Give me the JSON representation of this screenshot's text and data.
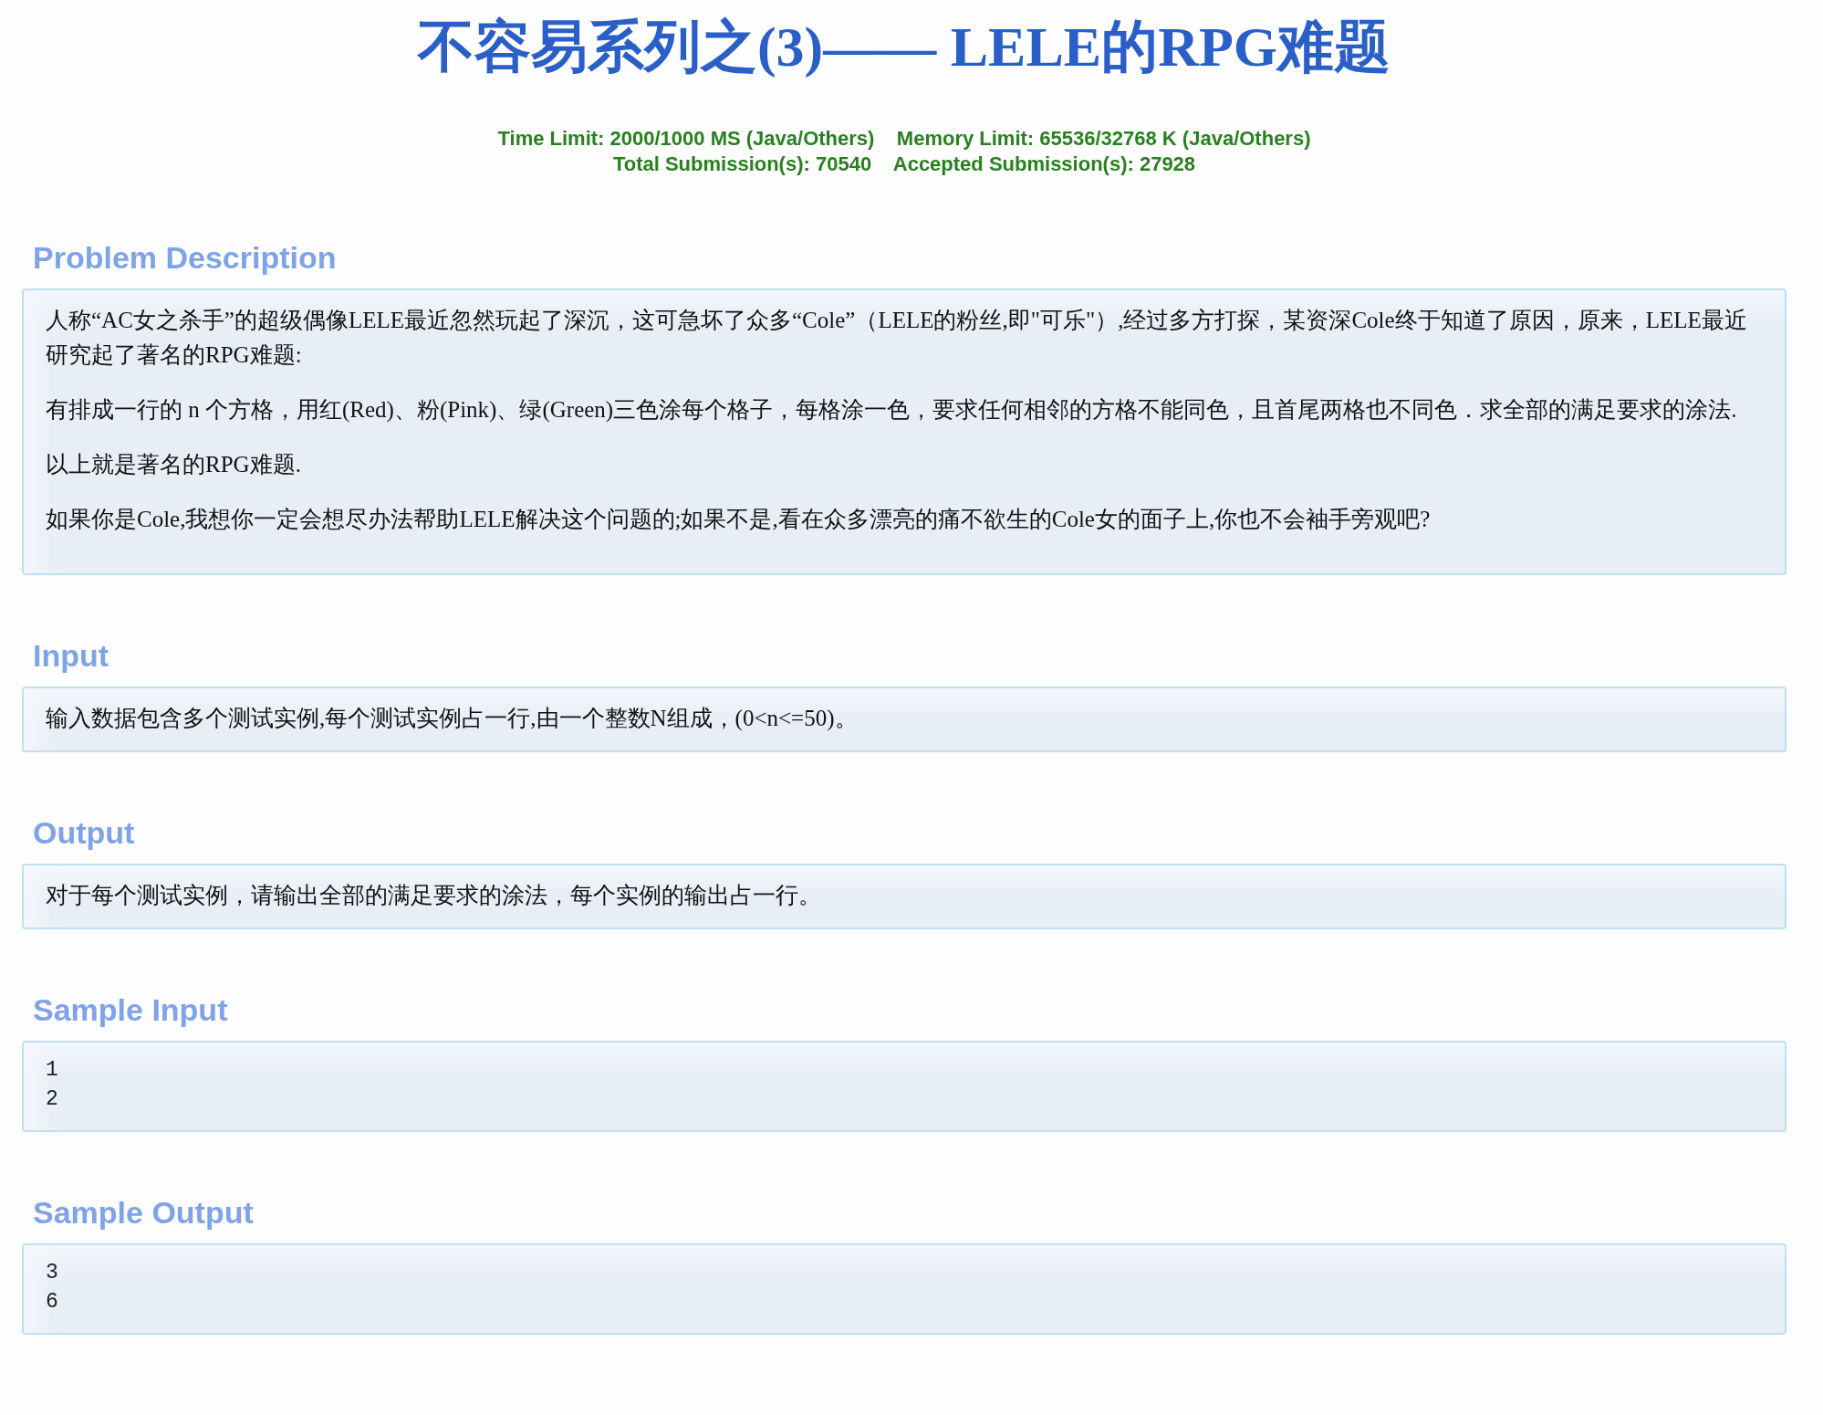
{
  "title": "不容易系列之(3)—— LELE的RPG难题",
  "limits": [
    "Time Limit: 2000/1000 MS (Java/Others)    Memory Limit: 65536/32768 K (Java/Others)",
    "Total Submission(s): 70540    Accepted Submission(s): 27928"
  ],
  "sections": [
    {
      "heading": "Problem Description",
      "kind": "text",
      "paragraphs": [
        "人称“AC女之杀手”的超级偶像LELE最近忽然玩起了深沉，这可急坏了众多“Cole”（LELE的粉丝,即\"可乐\"）,经过多方打探，某资深Cole终于知道了原因，原来，LELE最近研究起了著名的RPG难题:",
        "有排成一行的 n 个方格，用红(Red)、粉(Pink)、绿(Green)三色涂每个格子，每格涂一色，要求任何相邻的方格不能同色，且首尾两格也不同色．求全部的满足要求的涂法.",
        "以上就是著名的RPG难题.",
        "如果你是Cole,我想你一定会想尽办法帮助LELE解决这个问题的;如果不是,看在众多漂亮的痛不欲生的Cole女的面子上,你也不会袖手旁观吧?"
      ]
    },
    {
      "heading": "Input",
      "kind": "text",
      "paragraphs": [
        "输入数据包含多个测试实例,每个测试实例占一行,由一个整数N组成，(0<n<=50)。"
      ]
    },
    {
      "heading": "Output",
      "kind": "text",
      "paragraphs": [
        "对于每个测试实例，请输出全部的满足要求的涂法，每个实例的输出占一行。"
      ]
    },
    {
      "heading": "Sample Input",
      "kind": "code",
      "lines": [
        "1",
        "2"
      ]
    },
    {
      "heading": "Sample Output",
      "kind": "code",
      "lines": [
        "3",
        "6"
      ]
    }
  ]
}
